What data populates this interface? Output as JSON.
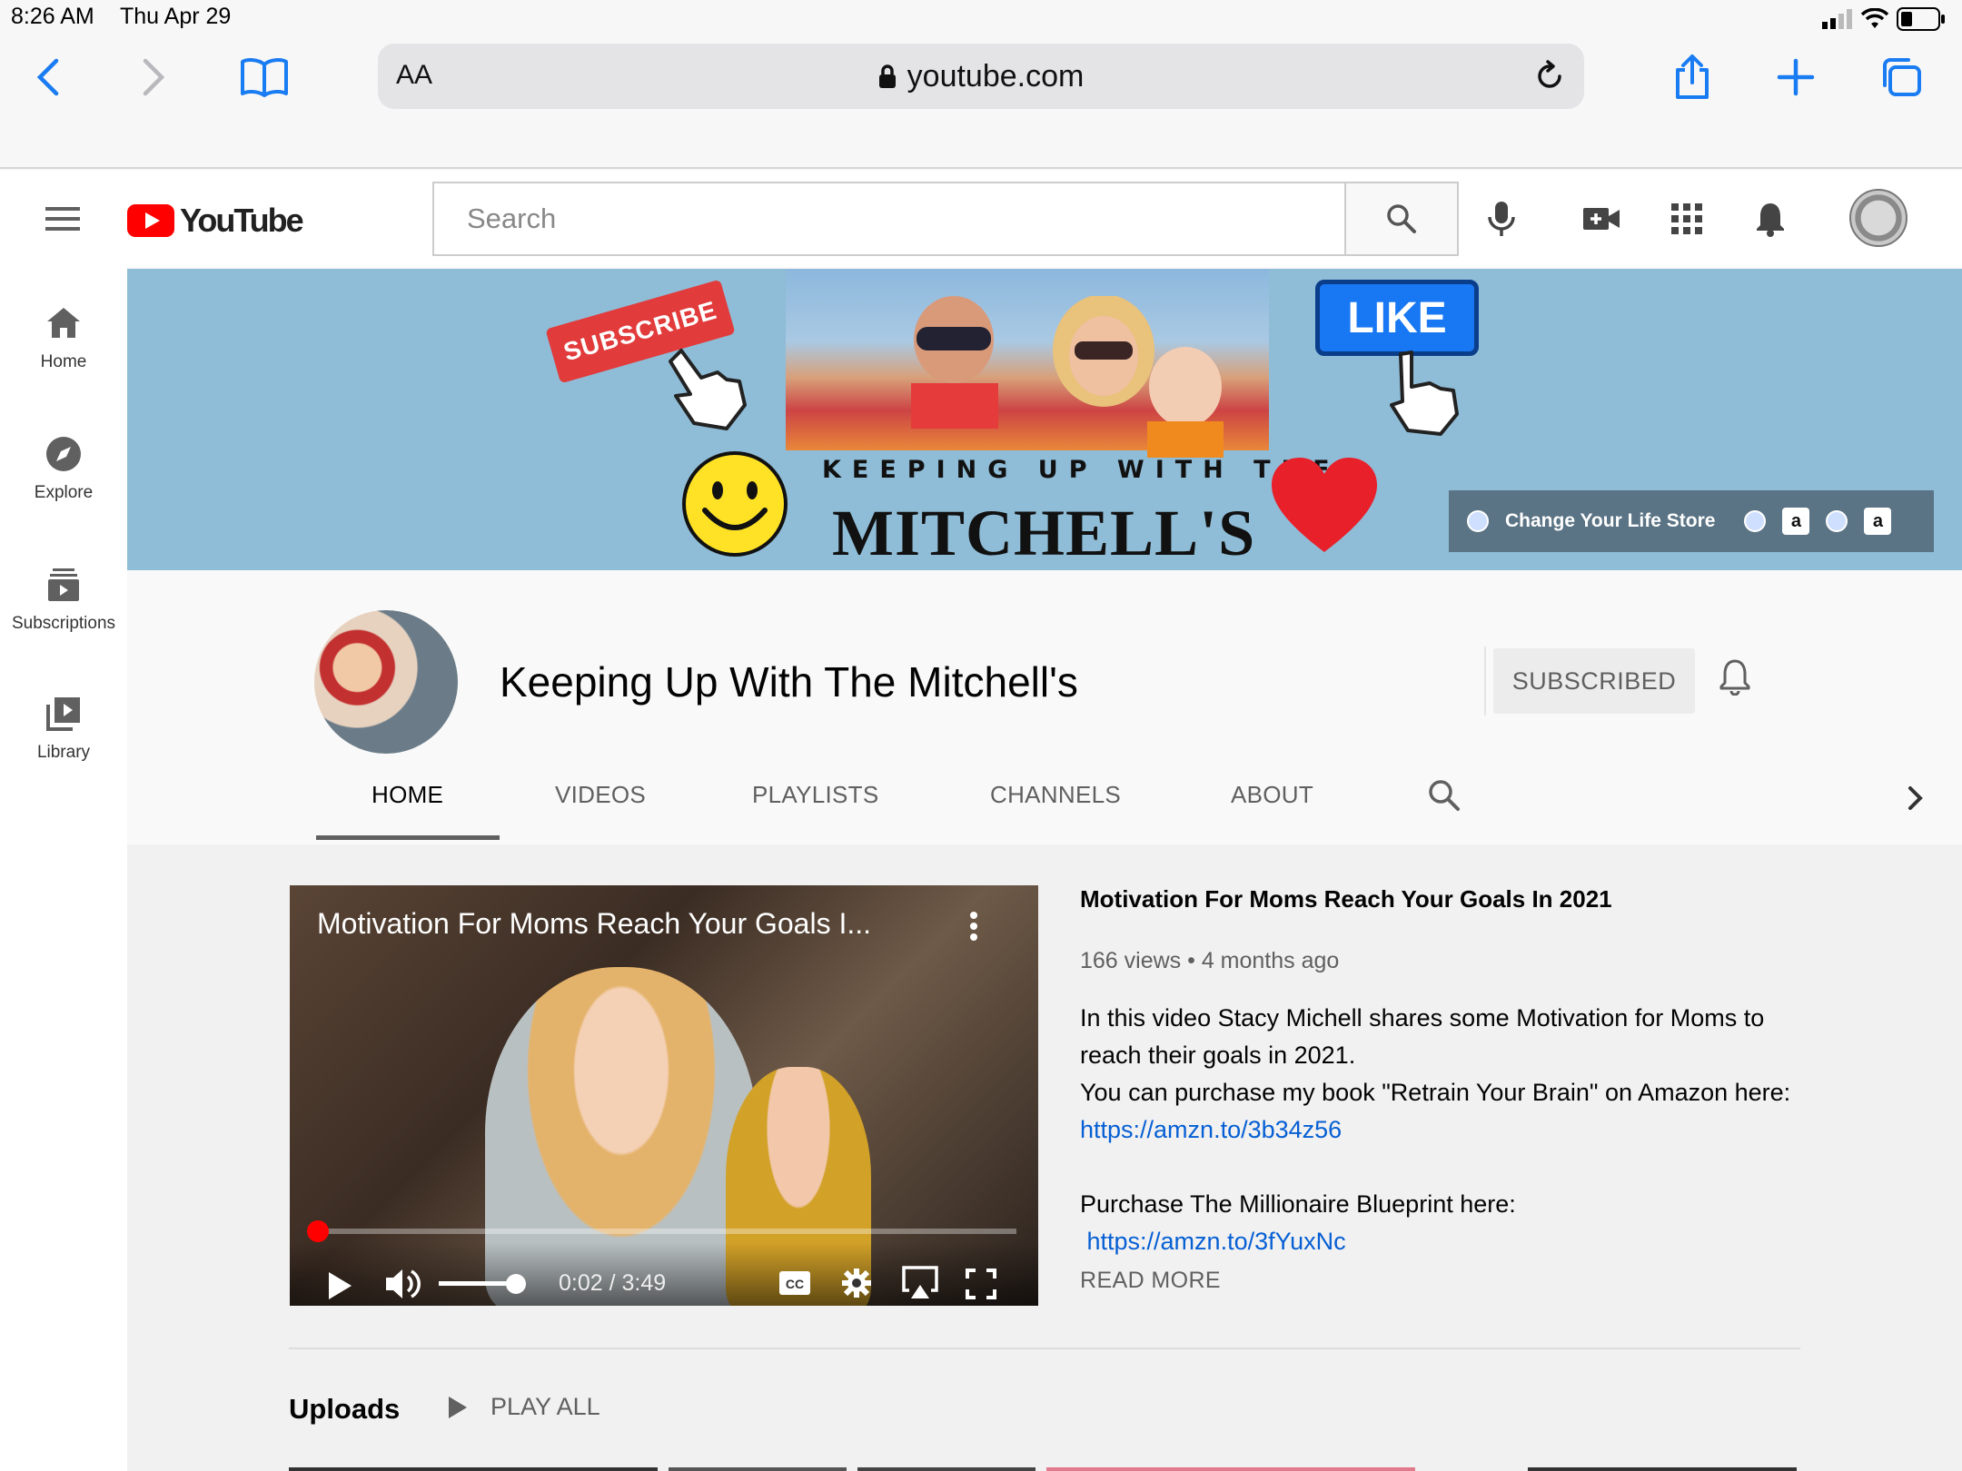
{
  "status_bar": {
    "time": "8:26 AM",
    "date": "Thu Apr 29"
  },
  "browser": {
    "text_size_label": "AA",
    "url": "youtube.com"
  },
  "masthead": {
    "logo_text": "YouTube",
    "search_placeholder": "Search"
  },
  "guide": {
    "items": [
      {
        "label": "Home",
        "icon": "home-icon"
      },
      {
        "label": "Explore",
        "icon": "compass-icon"
      },
      {
        "label": "Subscriptions",
        "icon": "subscriptions-icon"
      },
      {
        "label": "Library",
        "icon": "library-icon"
      }
    ]
  },
  "banner": {
    "subscribe_text": "SUBSCRIBE",
    "like_text": "LIKE",
    "heading_small": "KEEPING UP WITH THE",
    "heading_big": "MITCHELL'S",
    "store_text": "Change Your Life Store",
    "amazon_glyph": "a"
  },
  "channel": {
    "name": "Keeping Up With The Mitchell's",
    "subscribe_state": "SUBSCRIBED",
    "tabs": [
      "HOME",
      "VIDEOS",
      "PLAYLISTS",
      "CHANNELS",
      "ABOUT"
    ],
    "active_tab": "HOME"
  },
  "featured_video": {
    "overlay_title": "Motivation For Moms Reach Your Goals I...",
    "time_display": "0:02 / 3:49",
    "progress_fraction": 0.009,
    "volume_fraction": 0.85,
    "title": "Motivation For Moms Reach Your Goals In 2021",
    "meta": "166 views • 4 months ago",
    "description_lines": [
      "In this video Stacy Michell shares some Motivation for Moms to",
      "reach their goals in 2021.",
      "You can purchase my book \"Retrain Your Brain\" on Amazon here:"
    ],
    "link_1": "https://amzn.to/3b34z56",
    "line_after_gap": "Purchase The Millionaire Blueprint here:",
    "link_2": " https://amzn.to/3fYuxNc",
    "read_more": "READ MORE"
  },
  "uploads": {
    "label": "Uploads",
    "play_all": "PLAY ALL"
  },
  "colors": {
    "youtube_red": "#ff0000",
    "link_blue": "#065fd4",
    "safari_blue": "#1a7cf2"
  }
}
